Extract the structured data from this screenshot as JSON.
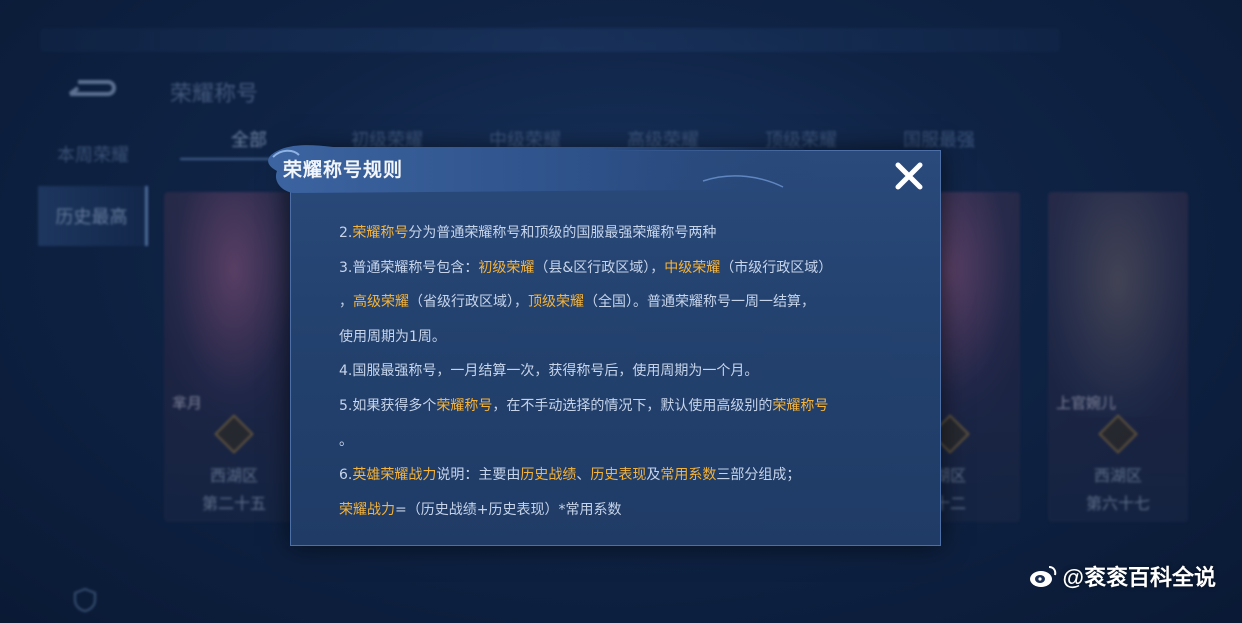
{
  "background": {
    "title": "荣耀称号",
    "side_tabs": [
      "本周荣耀",
      "历史最高"
    ],
    "tabs": [
      "全部",
      "初级荣耀",
      "中级荣耀",
      "高级荣耀",
      "顶级荣耀",
      "国服最强"
    ],
    "cards": [
      {
        "name": "芈月",
        "region": "西湖区",
        "rank": "第二十五"
      },
      {
        "name": "上官婉儿",
        "region": "西湖区",
        "rank": "第六十七"
      }
    ],
    "partial_card": {
      "region": "湖区",
      "rank": "十二"
    }
  },
  "modal": {
    "title": "荣耀称号规则",
    "lines": [
      [
        {
          "t": "2."
        },
        {
          "t": "荣耀称号",
          "h": true
        },
        {
          "t": "分为普通荣耀称号和顶级的国服最强荣耀称号两种"
        }
      ],
      [
        {
          "t": "3.普通荣耀称号包含："
        },
        {
          "t": "初级荣耀",
          "h": true
        },
        {
          "t": "（县&区行政区域），"
        },
        {
          "t": "中级荣耀",
          "h": true
        },
        {
          "t": "（市级行政区域）"
        }
      ],
      [
        {
          "t": "，"
        },
        {
          "t": "高级荣耀",
          "h": true
        },
        {
          "t": "（省级行政区域），"
        },
        {
          "t": "顶级荣耀",
          "h": true
        },
        {
          "t": "（全国）。普通荣耀称号一周一结算，"
        }
      ],
      [
        {
          "t": "使用周期为1周。"
        }
      ],
      [
        {
          "t": "4.国服最强称号，一月结算一次，获得称号后，使用周期为一个月。"
        }
      ],
      [
        {
          "t": "5.如果获得多个"
        },
        {
          "t": "荣耀称号",
          "h": true
        },
        {
          "t": "，在不手动选择的情况下，默认使用高级别的"
        },
        {
          "t": "荣耀称号",
          "h": true
        }
      ],
      [
        {
          "t": "。"
        }
      ],
      [
        {
          "t": "6."
        },
        {
          "t": "英雄荣耀战力",
          "h": true
        },
        {
          "t": "说明：主要由"
        },
        {
          "t": "历史战绩",
          "h": true
        },
        {
          "t": "、"
        },
        {
          "t": "历史表现",
          "h": true
        },
        {
          "t": "及"
        },
        {
          "t": "常用系数",
          "h": true
        },
        {
          "t": "三部分组成；"
        }
      ],
      [
        {
          "t": "荣耀战力",
          "h": true
        },
        {
          "t": "=（历史战绩+历史表现）*常用系数"
        }
      ]
    ]
  },
  "watermark": "@衮衮百科全说",
  "colors": {
    "highlight": "#f4b33a",
    "modal_bg": "#24426f",
    "body_text": "#c6d4ea"
  }
}
